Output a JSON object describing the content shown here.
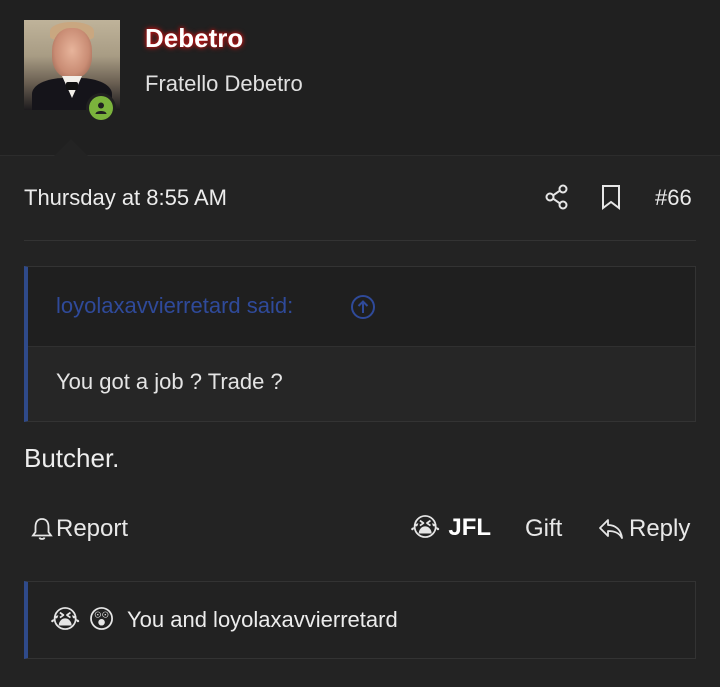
{
  "user": {
    "name": "Debetro",
    "title": "Fratello Debetro"
  },
  "post": {
    "timestamp": "Thursday at 8:55 AM",
    "number": "#66",
    "text": "Butcher."
  },
  "quote": {
    "author": "loyolaxavvierretard said:",
    "body": "You got a job ? Trade ?"
  },
  "actions": {
    "report": "Report",
    "reaction_emoji": "😭",
    "reaction_label": "JFL",
    "gift": "Gift",
    "reply": "Reply"
  },
  "reactions": {
    "emojis": [
      "😭",
      "😲"
    ],
    "summary": "You and loyolaxavvierretard"
  },
  "colors": {
    "background": "#232323",
    "username_glow": "#d11b1b",
    "quote_accent": "#2f4a8a",
    "online": "#7bb33c"
  }
}
